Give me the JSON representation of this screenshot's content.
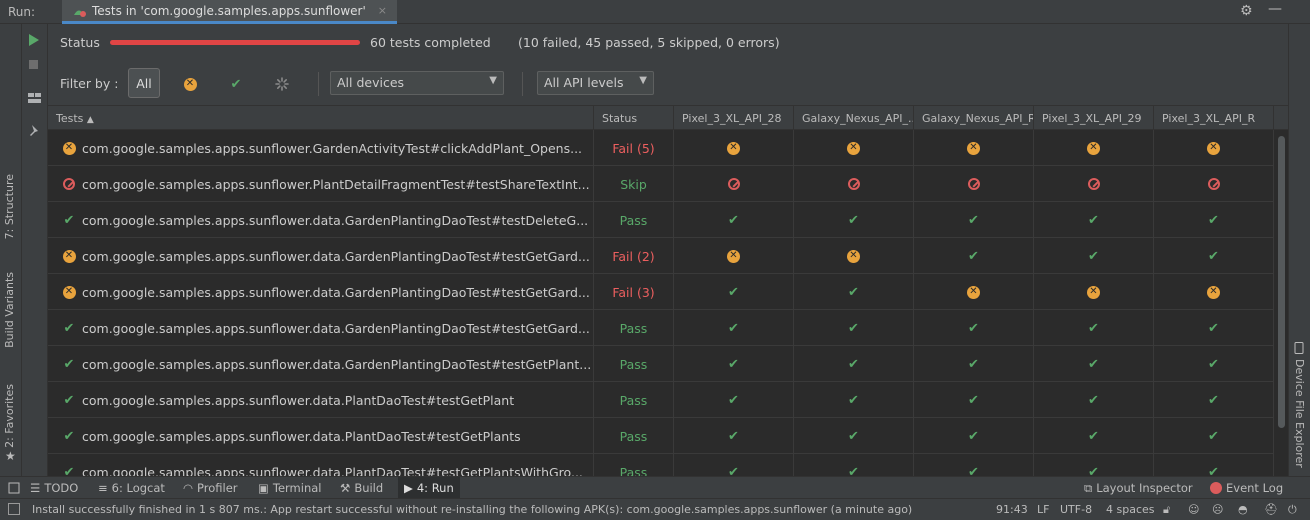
{
  "top": {
    "run_label": "Run:",
    "tab_title": "Tests in 'com.google.samples.apps.sunflower'",
    "tab_close": "×",
    "gear_glyph": "⚙",
    "minimize_glyph": "—"
  },
  "left_strip": {
    "structure": "7: Structure",
    "build_variants": "Build Variants",
    "favorites": "2: Favorites"
  },
  "right_strip": {
    "device_file_explorer": "Device File Explorer"
  },
  "status": {
    "label": "Status",
    "progress_fraction": 1.0,
    "completed": "60 tests completed",
    "summary": "(10 failed, 45 passed, 5 skipped, 0 errors)"
  },
  "filter": {
    "label": "Filter by :",
    "all_label": "All",
    "devices_dropdown": "All devices",
    "api_dropdown": "All API levels"
  },
  "table": {
    "headers": {
      "tests": "Tests",
      "status": "Status",
      "d1": "Pixel_3_XL_API_28",
      "d2": "Galaxy_Nexus_API_...",
      "d3": "Galaxy_Nexus_API_R",
      "d4": "Pixel_3_XL_API_29",
      "d5": "Pixel_3_XL_API_R"
    },
    "rows": [
      {
        "name": "com.google.samples.apps.sunflower.GardenActivityTest#clickAddPlant_Opens...",
        "status_type": "fail",
        "status": "Fail (5)",
        "devices": [
          "fail",
          "fail",
          "fail",
          "fail",
          "fail"
        ]
      },
      {
        "name": "com.google.samples.apps.sunflower.PlantDetailFragmentTest#testShareTextInt...",
        "status_type": "skip",
        "status": "Skip",
        "devices": [
          "skip",
          "skip",
          "skip",
          "skip",
          "skip"
        ]
      },
      {
        "name": "com.google.samples.apps.sunflower.data.GardenPlantingDaoTest#testDeleteG...",
        "status_type": "pass",
        "status": "Pass",
        "devices": [
          "pass",
          "pass",
          "pass",
          "pass",
          "pass"
        ]
      },
      {
        "name": "com.google.samples.apps.sunflower.data.GardenPlantingDaoTest#testGetGard...",
        "status_type": "fail",
        "status": "Fail (2)",
        "devices": [
          "fail",
          "fail",
          "pass",
          "pass",
          "pass"
        ]
      },
      {
        "name": "com.google.samples.apps.sunflower.data.GardenPlantingDaoTest#testGetGard...",
        "status_type": "fail",
        "status": "Fail (3)",
        "devices": [
          "pass",
          "pass",
          "fail",
          "fail",
          "fail"
        ]
      },
      {
        "name": "com.google.samples.apps.sunflower.data.GardenPlantingDaoTest#testGetGard...",
        "status_type": "pass",
        "status": "Pass",
        "devices": [
          "pass",
          "pass",
          "pass",
          "pass",
          "pass"
        ]
      },
      {
        "name": "com.google.samples.apps.sunflower.data.GardenPlantingDaoTest#testGetPlant...",
        "status_type": "pass",
        "status": "Pass",
        "devices": [
          "pass",
          "pass",
          "pass",
          "pass",
          "pass"
        ]
      },
      {
        "name": "com.google.samples.apps.sunflower.data.PlantDaoTest#testGetPlant",
        "status_type": "pass",
        "status": "Pass",
        "devices": [
          "pass",
          "pass",
          "pass",
          "pass",
          "pass"
        ]
      },
      {
        "name": "com.google.samples.apps.sunflower.data.PlantDaoTest#testGetPlants",
        "status_type": "pass",
        "status": "Pass",
        "devices": [
          "pass",
          "pass",
          "pass",
          "pass",
          "pass"
        ]
      },
      {
        "name": "com.google.samples.apps.sunflower.data.PlantDaoTest#testGetPlantsWithGro...",
        "status_type": "pass",
        "status": "Pass",
        "devices": [
          "pass",
          "pass",
          "pass",
          "pass",
          "pass"
        ]
      }
    ]
  },
  "tools": {
    "todo": "TODO",
    "logcat": "6: Logcat",
    "profiler": "Profiler",
    "terminal": "Terminal",
    "build": "Build",
    "run": "4: Run",
    "layout_inspector": "Layout Inspector",
    "event_log": "Event Log"
  },
  "statusbar": {
    "message": "Install successfully finished in 1 s 807 ms.: App restart successful without re-installing the following APK(s): com.google.samples.apps.sunflower (a minute ago)",
    "position": "91:43",
    "line_sep": "LF",
    "encoding": "UTF-8",
    "indent": "4 spaces"
  },
  "colors": {
    "fail": "#e8a33d",
    "skip": "#db5c5c",
    "pass": "#59a869",
    "progress": "#e04545",
    "accent": "#4a88c7"
  }
}
